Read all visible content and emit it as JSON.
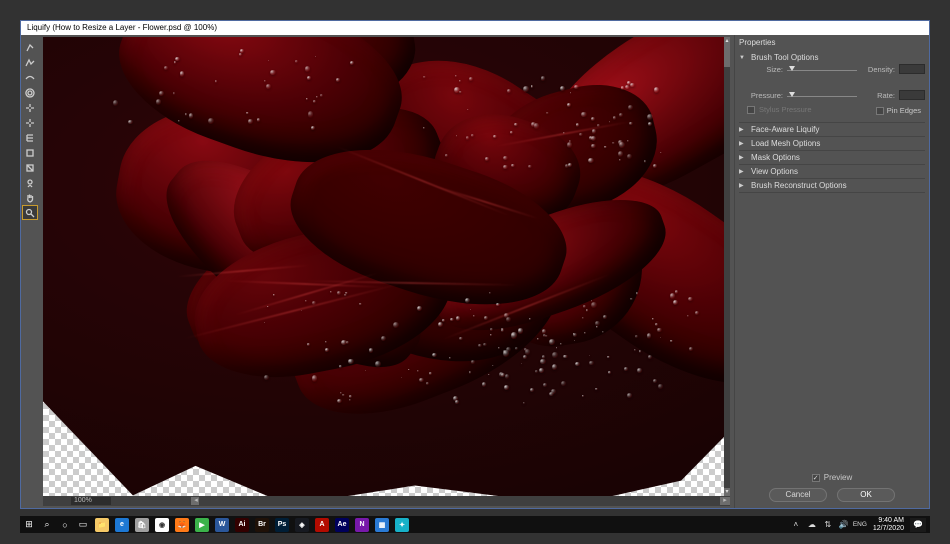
{
  "window": {
    "title": "Liquify (How to Resize a Layer - Flower.psd @ 100%)"
  },
  "tools": [
    {
      "name": "forward-warp-tool"
    },
    {
      "name": "reconstruct-tool"
    },
    {
      "name": "smooth-tool"
    },
    {
      "name": "twirl-tool"
    },
    {
      "name": "pucker-tool"
    },
    {
      "name": "bloat-tool"
    },
    {
      "name": "push-left-tool"
    },
    {
      "name": "freeze-mask-tool"
    },
    {
      "name": "thaw-mask-tool"
    },
    {
      "name": "face-tool"
    },
    {
      "name": "hand-tool"
    },
    {
      "name": "zoom-tool",
      "selected": true
    }
  ],
  "canvas": {
    "zoom_label": "100%"
  },
  "panel": {
    "title": "Properties",
    "brush_section": "Brush Tool Options",
    "labels": {
      "size": "Size:",
      "density": "Density:",
      "pressure": "Pressure:",
      "rate": "Rate:"
    },
    "stylus_pressure": "Stylus Pressure",
    "pin_edges": "Pin Edges",
    "sections": {
      "face": "Face-Aware Liquify",
      "mesh": "Load Mesh Options",
      "mask": "Mask Options",
      "view": "View Options",
      "reconstruct": "Brush Reconstruct Options"
    },
    "preview": "Preview",
    "cancel": "Cancel",
    "ok": "OK"
  },
  "taskbar": {
    "apps": [
      {
        "name": "start",
        "bg": "#101010",
        "label": "⊞"
      },
      {
        "name": "search",
        "bg": "#101010",
        "label": "⌕"
      },
      {
        "name": "cortana",
        "bg": "#101010",
        "label": "○"
      },
      {
        "name": "taskview",
        "bg": "#101010",
        "label": "▭"
      },
      {
        "name": "file-explorer",
        "bg": "#f5c967",
        "label": "📁"
      },
      {
        "name": "edge",
        "bg": "#1d78d4",
        "label": "e"
      },
      {
        "name": "store",
        "bg": "#a0a0a0",
        "label": "🛍"
      },
      {
        "name": "chrome",
        "bg": "#ffffff",
        "label": "◉"
      },
      {
        "name": "firefox",
        "bg": "#ff7a18",
        "label": "🦊"
      },
      {
        "name": "app-green",
        "bg": "#3bb34a",
        "label": "▶"
      },
      {
        "name": "word",
        "bg": "#2b579a",
        "label": "W"
      },
      {
        "name": "illustrator",
        "bg": "#330000",
        "label": "Ai"
      },
      {
        "name": "bridge",
        "bg": "#1f1108",
        "label": "Br"
      },
      {
        "name": "photoshop",
        "bg": "#001e36",
        "label": "Ps"
      },
      {
        "name": "steam",
        "bg": "#171a21",
        "label": "◈"
      },
      {
        "name": "acrobat",
        "bg": "#b30b00",
        "label": "A"
      },
      {
        "name": "after-effects",
        "bg": "#00005b",
        "label": "Ae"
      },
      {
        "name": "onenote",
        "bg": "#7719aa",
        "label": "N"
      },
      {
        "name": "app-blue",
        "bg": "#2a7ad4",
        "label": "▦"
      },
      {
        "name": "app-teal",
        "bg": "#17b1c8",
        "label": "✦"
      }
    ],
    "time": "9:40 AM",
    "date": "12/7/2020"
  }
}
